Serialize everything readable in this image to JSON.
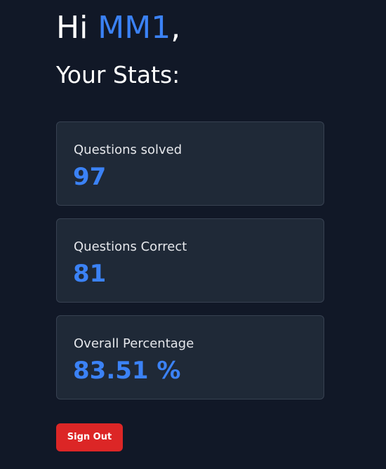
{
  "greeting": {
    "prefix": "Hi ",
    "username": "MM1",
    "suffix": ","
  },
  "subtitle": "Your Stats:",
  "stats": [
    {
      "label": "Questions solved",
      "value": "97"
    },
    {
      "label": "Questions Correct",
      "value": "81"
    },
    {
      "label": "Overall Percentage",
      "value": "83.51 %"
    }
  ],
  "actions": {
    "sign_out_label": "Sign Out"
  },
  "colors": {
    "background": "#111827",
    "card": "#1f2937",
    "accent": "#3b82f6",
    "danger": "#dc2626"
  }
}
